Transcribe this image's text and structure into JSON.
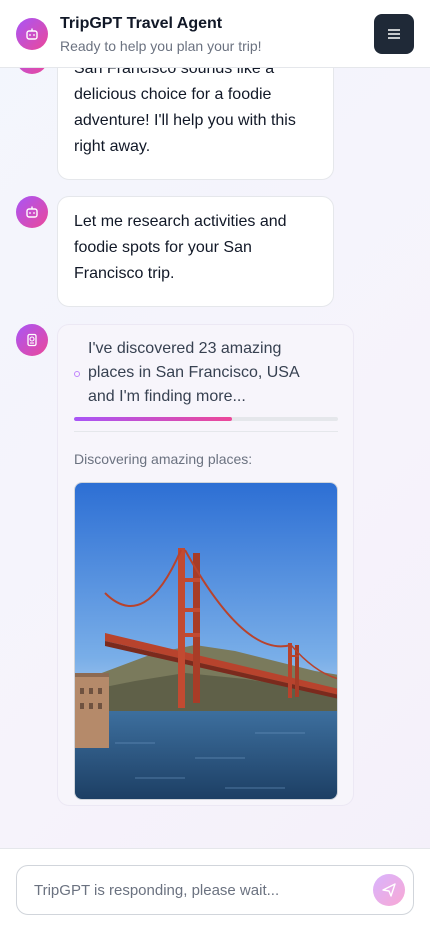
{
  "header": {
    "title": "TripGPT Travel Agent",
    "subtitle": "Ready to help you plan your trip!",
    "avatar_icon": "robot-icon",
    "menu_icon": "menu-icon"
  },
  "messages": [
    {
      "text": "San Francisco sounds like a delicious choice for a foodie adventure! I'll help you with this right away.",
      "icon": "robot-icon"
    },
    {
      "text": "Let me research activities and foodie spots for your San Francisco trip.",
      "icon": "robot-icon"
    }
  ],
  "discovery": {
    "icon": "passport-icon",
    "status": "I've discovered 23 amazing places in San Francisco, USA and I'm finding more...",
    "progress": 0.6,
    "label": "Discovering amazing places:",
    "photo": "golden-gate-bridge-photo"
  },
  "composer": {
    "placeholder": "TripGPT is responding, please wait...",
    "send_icon": "send-icon"
  },
  "colors": {
    "accent_start": "#a855f7",
    "accent_end": "#ec4899",
    "menu_button": "#1f2937"
  }
}
